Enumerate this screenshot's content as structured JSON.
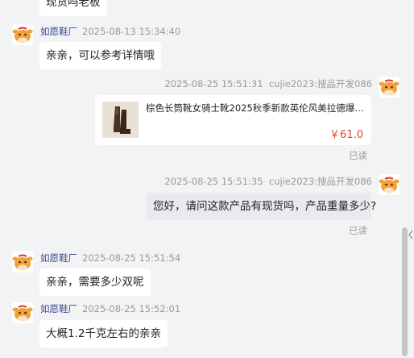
{
  "messages": [
    {
      "side": "left",
      "text": "现货吗老板"
    },
    {
      "side": "left",
      "sender": "如愿鞋厂",
      "time": "2025-08-13 15:34:40",
      "text": "亲亲，可以参考详情哦"
    },
    {
      "side": "right",
      "time": "2025-08-25 15:51:31",
      "sender": "cujie2023:搜品开发086",
      "product": {
        "title": "棕色长筒靴女骑士靴2025秋季新款英伦风美拉德爆款瘦...",
        "price": "￥61.0"
      },
      "read": "已读"
    },
    {
      "side": "right",
      "time": "2025-08-25 15:51:35",
      "sender": "cujie2023:搜品开发086",
      "text": "您好，请问这款产品有现货吗，产品重量多少?",
      "read": "已读"
    },
    {
      "side": "left",
      "sender": "如愿鞋厂",
      "time": "2025-08-25 15:51:54",
      "text": "亲亲，需要多少双呢"
    },
    {
      "side": "left",
      "sender": "如愿鞋厂",
      "time": "2025-08-25 15:52:01",
      "text": "大概1.2千克左右的亲亲"
    }
  ],
  "colors": {
    "background": "#f2f3f5",
    "bubble": "#ffffff",
    "own_bubble": "#e9eaed",
    "price": "#e8472c",
    "sender_name": "#3a4a8a"
  },
  "icons": {
    "avatar": "cartoon-cow-avatar-icon"
  }
}
